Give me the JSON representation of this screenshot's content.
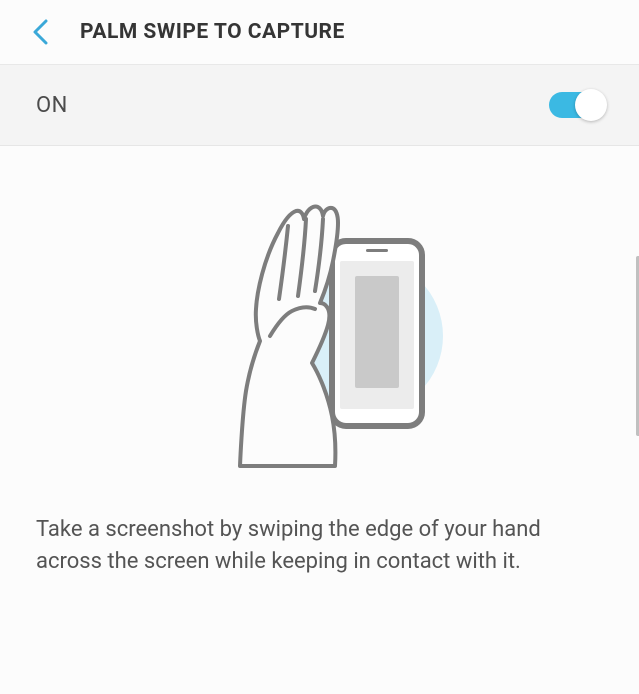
{
  "header": {
    "title": "PALM SWIPE TO CAPTURE"
  },
  "toggle": {
    "label": "ON",
    "state": true
  },
  "content": {
    "description": "Take a screenshot by swiping the edge of your hand across the screen while keeping in contact with it."
  }
}
